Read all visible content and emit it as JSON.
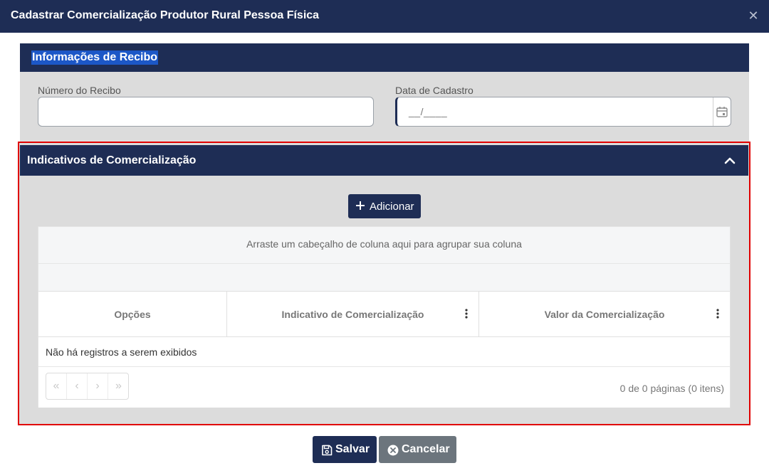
{
  "dialog": {
    "title": "Cadastrar Comercialização Produtor Rural Pessoa Física",
    "close_icon": "close-icon"
  },
  "receipt": {
    "header": "Informações de Recibo",
    "receipt_number_label": "Número do Recibo",
    "receipt_number_value": "",
    "date_label": "Data de Cadastro",
    "date_mask": "__/____",
    "calendar_icon": "calendar-icon"
  },
  "indicatives": {
    "header": "Indicativos de Comercialização",
    "collapse_icon": "chevron-up-icon",
    "add_label": "Adicionar",
    "grid": {
      "group_panel_text": "Arraste um cabeçalho de coluna aqui para agrupar sua coluna",
      "columns": [
        "Opções",
        "Indicativo de Comercialização",
        "Valor da Comercialização"
      ],
      "empty_text": "Não há registros a serem exibidos",
      "pager_buttons": [
        "«",
        "‹",
        "›",
        "»"
      ],
      "pager_info": "0 de 0 páginas (0 itens)"
    }
  },
  "footer": {
    "save_label": "Salvar",
    "cancel_label": "Cancelar"
  },
  "colors": {
    "navy": "#1e2d55",
    "highlight_border": "#e00000",
    "section_bg": "#dcdcdc",
    "cancel_gray": "#6c757d"
  }
}
